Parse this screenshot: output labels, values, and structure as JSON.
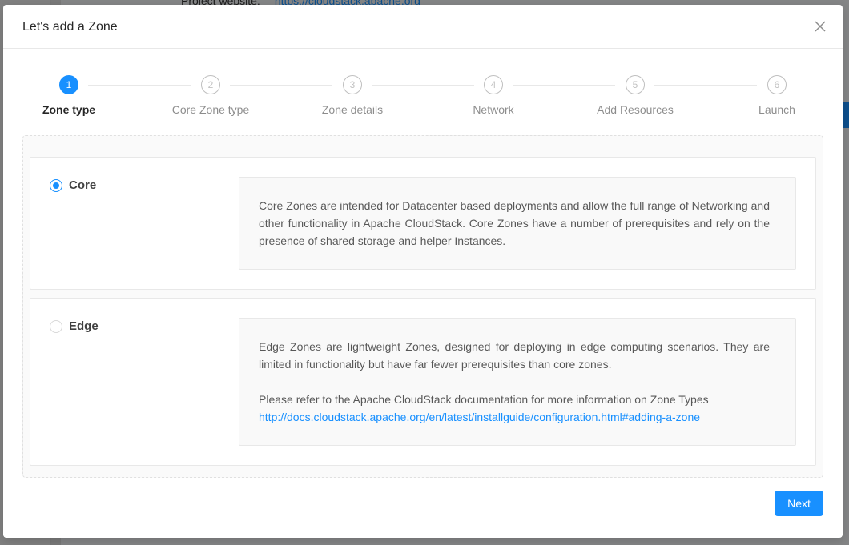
{
  "background": {
    "project_label": "Project website:",
    "project_link": "https://cloudstack.apache.org"
  },
  "modal": {
    "title": "Let's add a Zone",
    "close_icon": "close-icon"
  },
  "steps": [
    {
      "number": "1",
      "label": "Zone type",
      "active": true
    },
    {
      "number": "2",
      "label": "Core Zone type",
      "active": false
    },
    {
      "number": "3",
      "label": "Zone details",
      "active": false
    },
    {
      "number": "4",
      "label": "Network",
      "active": false
    },
    {
      "number": "5",
      "label": "Add Resources",
      "active": false
    },
    {
      "number": "6",
      "label": "Launch",
      "active": false
    }
  ],
  "options": {
    "core": {
      "label": "Core",
      "selected": true,
      "description": "Core Zones are intended for Datacenter based deployments and allow the full range of Networking and other functionality in Apache CloudStack. Core Zones have a number of prerequisites and rely on the presence of shared storage and helper Instances."
    },
    "edge": {
      "label": "Edge",
      "selected": false,
      "description": "Edge Zones are lightweight Zones, designed for deploying in edge computing scenarios. They are limited in functionality but have far fewer prerequisites than core zones.",
      "doc_text": "Please refer to the Apache CloudStack documentation for more information on Zone Types",
      "doc_link": "http://docs.cloudstack.apache.org/en/latest/installguide/configuration.html#adding-a-zone"
    }
  },
  "footer": {
    "next_label": "Next"
  },
  "colors": {
    "primary": "#1890ff",
    "mask": "rgba(0,0,0,0.45)"
  }
}
